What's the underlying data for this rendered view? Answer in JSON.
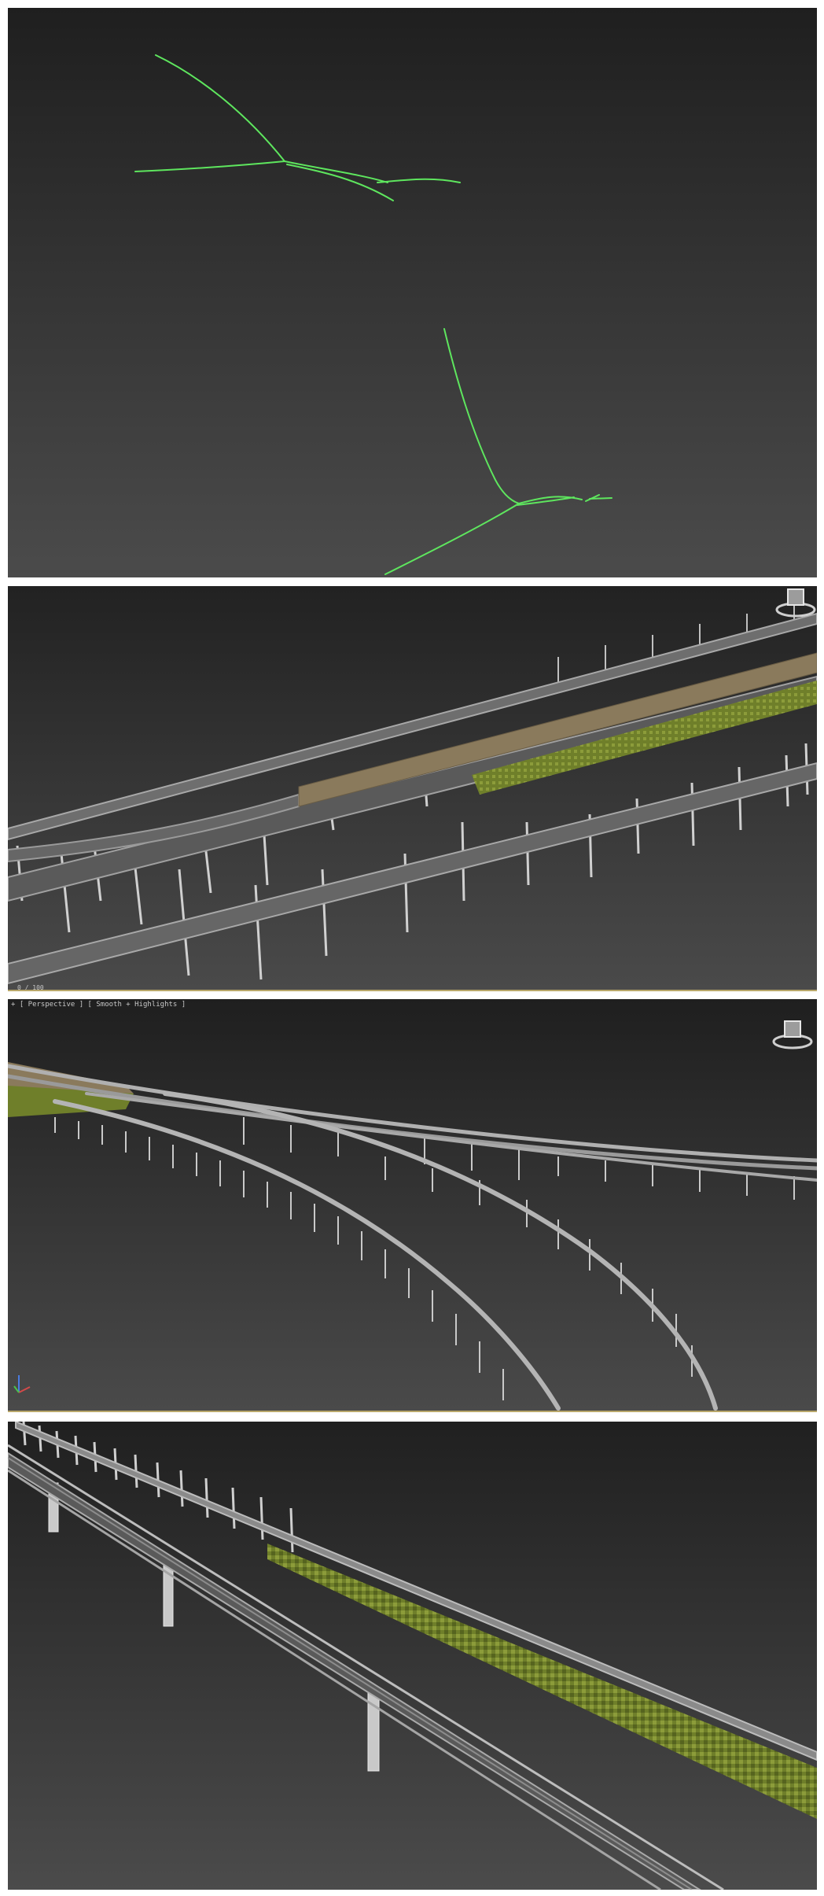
{
  "viewports": [
    {
      "id": "spline-view",
      "content": "spline-network"
    },
    {
      "id": "bridge-closeup-view",
      "frame_counter": "0 / 100"
    },
    {
      "id": "perspective-view",
      "label": "+ [ Perspective ] [ Smooth + Highlights ]"
    },
    {
      "id": "deck-detail-view"
    }
  ],
  "colors": {
    "viewport_bg_top": "#202020",
    "viewport_bg_bottom": "#4a4a4a",
    "spline": "#5ee65e",
    "rail": "#9a9a9a",
    "deck": "#6e6e6e",
    "pier": "#c8c8c8",
    "gravel": "#8a7a5c",
    "vegetation": "#6f7f2a",
    "timeline": "#b9a76a"
  },
  "icons": [
    "viewcube-icon",
    "axis-gizmo-icon"
  ]
}
